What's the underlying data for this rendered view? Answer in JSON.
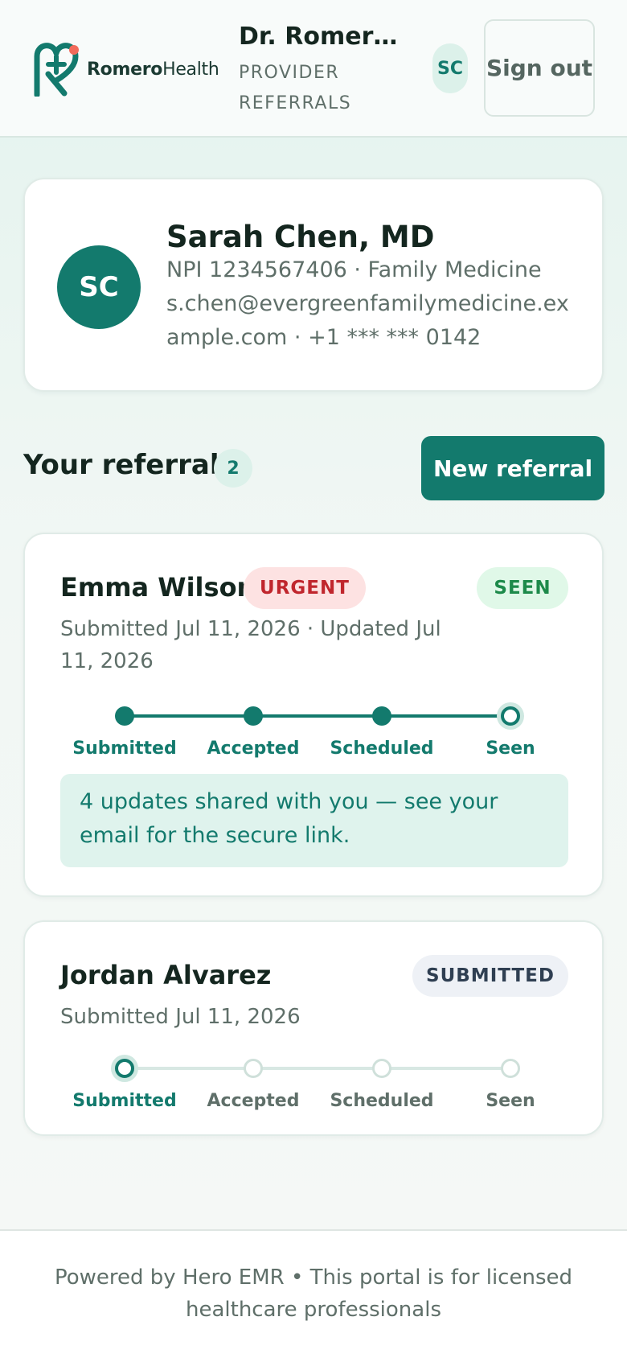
{
  "header": {
    "brand_bold": "Romero",
    "brand_light": "Health",
    "provider_name": "Dr. Romero Health",
    "portal_label": "PROVIDER REFERRALS",
    "avatar_initials": "SC",
    "sign_out_label": "Sign out"
  },
  "profile": {
    "initials": "SC",
    "name": "Sarah Chen, MD",
    "npi_line": "NPI 1234567406 · Family Medicine",
    "contact_line": "s.chen@evergreenfamilymedicine.example.com · +1 *** *** 0142"
  },
  "referrals_section": {
    "title": "Your referrals",
    "count": "2",
    "new_button_label": "New referral"
  },
  "referrals": [
    {
      "patient": "Emma Wilson",
      "priority": "URGENT",
      "status": "SEEN",
      "dates": "Submitted Jul 11, 2026 · Updated Jul 11, 2026",
      "steps": [
        "Submitted",
        "Accepted",
        "Scheduled",
        "Seen"
      ],
      "current_step": 4,
      "notice": "4 updates shared with you — see your email for the secure link."
    },
    {
      "patient": "Jordan Alvarez",
      "status": "SUBMITTED",
      "dates": "Submitted Jul 11, 2026",
      "steps": [
        "Submitted",
        "Accepted",
        "Scheduled",
        "Seen"
      ],
      "current_step": 1
    }
  ],
  "footer": {
    "text": "Powered by Hero EMR • This portal is for licensed healthcare professionals"
  },
  "colors": {
    "brand": "#137a6d",
    "brand_light": "#dcf1ea",
    "urgent": "#c0262d",
    "seen": "#1d8a4a",
    "logo_accent": "#f26b5b"
  }
}
